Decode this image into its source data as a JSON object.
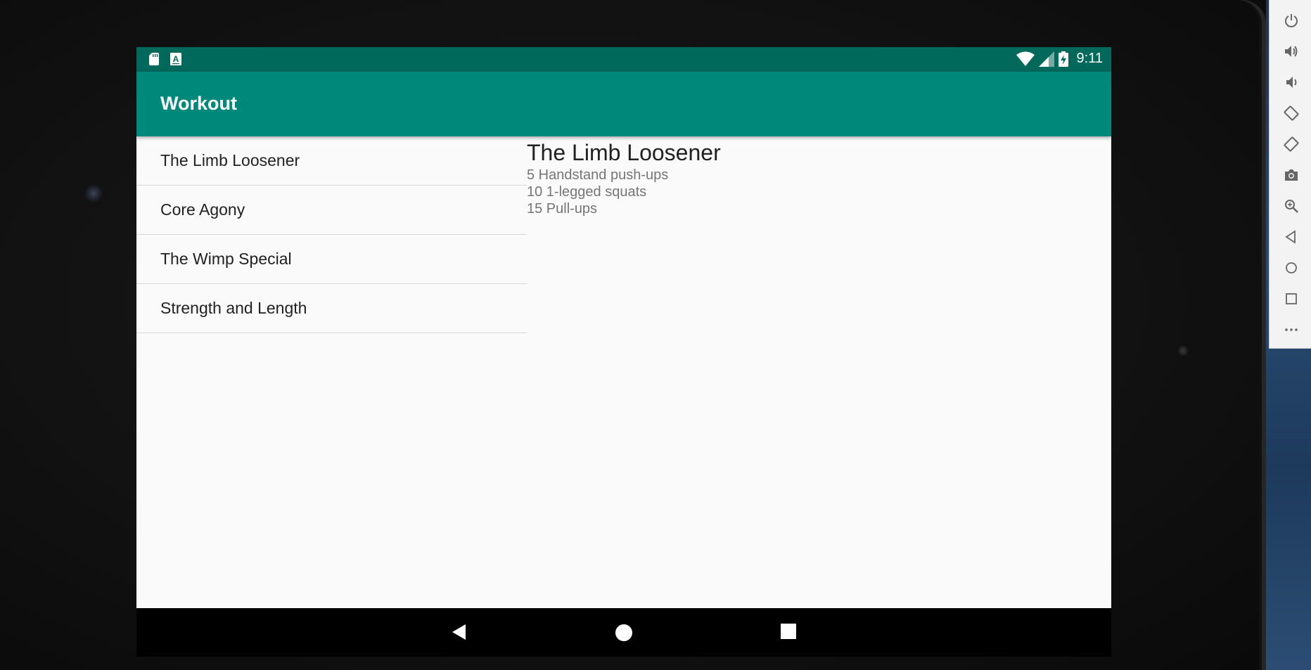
{
  "status_bar": {
    "time": "9:11"
  },
  "app_bar": {
    "title": "Workout"
  },
  "workouts": [
    {
      "label": "The Limb Loosener"
    },
    {
      "label": "Core Agony"
    },
    {
      "label": "The Wimp Special"
    },
    {
      "label": "Strength and Length"
    }
  ],
  "detail": {
    "title": "The Limb Loosener",
    "lines": [
      "5 Handstand push-ups",
      "10 1-legged squats",
      "15 Pull-ups"
    ]
  },
  "navigation": {
    "back_icon": "back-triangle-icon",
    "home_icon": "home-circle-icon",
    "recents_icon": "recents-square-icon"
  },
  "emulator_toolbar": {
    "icons": [
      "power-icon",
      "volume-up-icon",
      "volume-down-icon",
      "rotate-left-icon",
      "rotate-right-icon",
      "camera-icon",
      "zoom-icon",
      "back-icon",
      "home-icon",
      "overview-icon",
      "more-icon"
    ]
  },
  "colors": {
    "primary": "#00897b",
    "primary_dark": "#00695c",
    "background": "#fafafa"
  }
}
